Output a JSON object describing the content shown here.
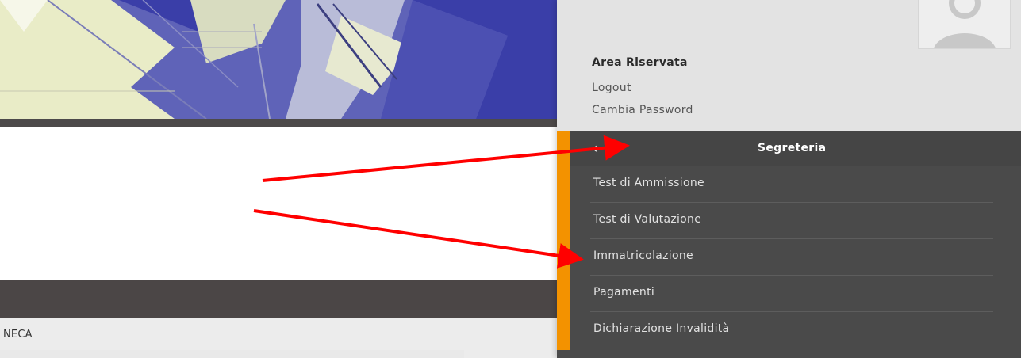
{
  "banner": {
    "image": "architecture-photo"
  },
  "footer": {
    "text": "NECA"
  },
  "user": {
    "avatar_icon": "user-avatar-icon",
    "area_title": "Area Riservata",
    "logout_label": "Logout",
    "change_password_label": "Cambia Password"
  },
  "menu": {
    "back_icon": "chevron-left-icon",
    "title": "Segreteria",
    "items": [
      {
        "label": "Test di Ammissione"
      },
      {
        "label": "Test di Valutazione"
      },
      {
        "label": "Immatricolazione"
      },
      {
        "label": "Pagamenti"
      },
      {
        "label": "Dichiarazione Invalidità"
      }
    ]
  },
  "colors": {
    "accent": "#f39200",
    "menu_background": "#4a4a4a",
    "annotation_arrow": "#ff0000"
  }
}
